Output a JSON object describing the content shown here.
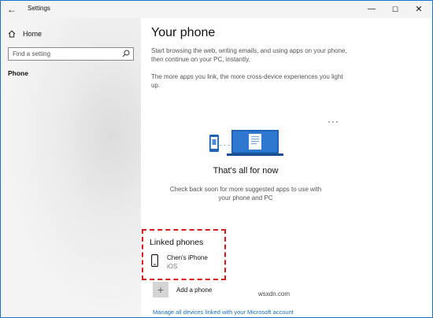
{
  "window": {
    "title": "Settings"
  },
  "titlebar": {
    "back_glyph": "←",
    "min_glyph": "—",
    "max_glyph": "☐",
    "close_glyph": "✕"
  },
  "sidebar": {
    "home_label": "Home",
    "search_placeholder": "Find a setting",
    "items": [
      {
        "label": "Phone",
        "selected": true
      }
    ]
  },
  "main": {
    "title": "Your phone",
    "desc1": "Start browsing the web, writing emails, and using apps on your phone, then continue on your PC, instantly.",
    "desc2": "The more apps you link, the more cross-device experiences you light up.",
    "more_glyph": "···",
    "all_title": "That's all for now",
    "all_sub": "Check back soon for more suggested apps to use with your phone and PC",
    "linked": {
      "title": "Linked phones",
      "devices": [
        {
          "name": "Chen's iPhone",
          "os": "iOS"
        }
      ]
    },
    "add_phone": {
      "glyph": "+",
      "label": "Add a phone"
    },
    "manage_link": "Manage all devices linked with your Microsoft account"
  },
  "watermark": "wsxdn.com",
  "colors": {
    "accent": "#1a73c8",
    "highlight_box": "#d9191c",
    "link": "#1a6fc2"
  }
}
